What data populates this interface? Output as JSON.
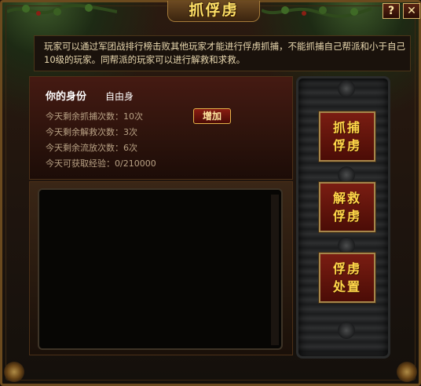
{
  "window": {
    "title": "抓俘虏",
    "help_label": "?",
    "close_label": "✕"
  },
  "info": {
    "text": "玩家可以通过军团战排行榜击败其他玩家才能进行俘虏抓捕，不能抓捕自己帮派和小于自己10级的玩家。同帮派的玩家可以进行解救和求救。"
  },
  "status": {
    "identity_label": "你的身份",
    "identity_value": "自由身",
    "capture_remaining": "今天剩余抓捕次数：10次",
    "rescue_remaining": "今天剩余解救次数：3次",
    "release_remaining": "今天剩余流放次数：6次",
    "exp_available": "今天可获取经验：0/210000",
    "add_button": "增加"
  },
  "sidebar": {
    "capture_btn": [
      "抓捕",
      "俘虏"
    ],
    "rescue_btn": [
      "解救",
      "俘虏"
    ],
    "manage_btn": [
      "俘虏",
      "处置"
    ]
  },
  "colors": {
    "accent_gold": "#ffd74a",
    "button_red": "#7a1d12",
    "frame_brown": "#6b4a1e"
  }
}
